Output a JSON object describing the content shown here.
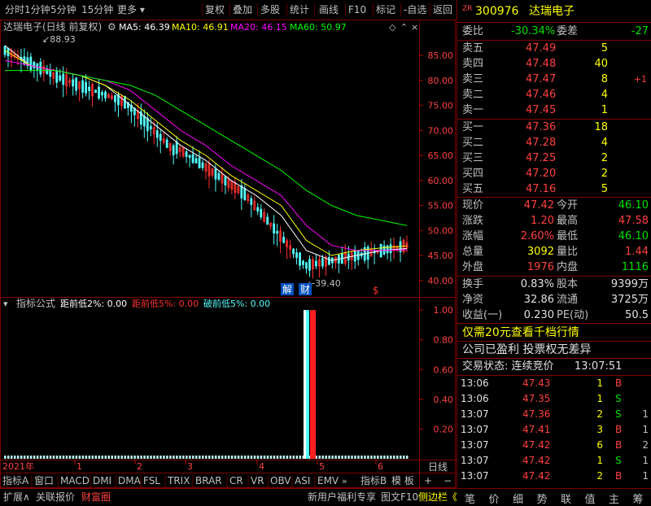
{
  "toolbar": {
    "items": [
      "分时",
      "1分钟",
      "5分钟",
      "15分钟",
      "更多",
      "复权",
      "叠加",
      "多股",
      "统计",
      "画线",
      "F10",
      "标记",
      "-自选",
      "返回"
    ]
  },
  "main_legend": {
    "title": "达瑞电子(日线 前复权)",
    "ma5": "MA5: 46.39",
    "ma10": "MA10: 46.91",
    "ma20": "MA20: 46.15",
    "ma60": "MA60: 50.97"
  },
  "indicator_legend": {
    "name": "指标公式",
    "f1": "距前低2%: 0.00",
    "f2": "距前低5%: 0.00",
    "f3": "破前低5%: 0.00"
  },
  "annotations": {
    "high": "88.93",
    "low": "39.40",
    "mark1": "解",
    "mark2": "财",
    "mark3": "$"
  },
  "axis": {
    "year_label": "2021年",
    "month_labels": [
      "1",
      "2",
      "3",
      "4",
      "5",
      "6"
    ],
    "period": "日线"
  },
  "colors": {
    "ma5": "#ffffff",
    "ma10": "#ffff00",
    "ma20": "#ff00ff",
    "ma60": "#00ff00",
    "up": "#ff3030",
    "down": "#54fcfc",
    "border": "#800000"
  },
  "chart_data": [
    {
      "type": "candlestick",
      "title": "达瑞电子(日线 前复权)",
      "y_ticks": [
        40.0,
        45.0,
        50.0,
        55.0,
        60.0,
        65.0,
        70.0,
        75.0,
        80.0,
        85.0
      ],
      "ylim": [
        38.5,
        88.93
      ],
      "series": [
        {
          "name": "MA5",
          "approx_values": [
            87,
            83,
            82,
            81,
            79,
            75,
            71,
            67,
            64,
            60,
            57,
            53,
            46,
            44,
            45,
            46,
            46.39
          ]
        },
        {
          "name": "MA10",
          "approx_values": [
            86,
            83,
            82,
            81,
            79,
            76,
            72,
            68,
            65,
            61,
            58,
            55,
            48,
            45,
            46,
            46.5,
            46.91
          ]
        },
        {
          "name": "MA20",
          "approx_values": [
            84,
            83,
            82,
            81,
            80,
            78,
            74,
            70,
            67,
            63,
            60,
            57,
            51,
            47,
            46,
            46,
            46.15
          ]
        },
        {
          "name": "MA60",
          "approx_values": [
            82,
            82,
            82,
            81,
            80,
            79,
            77,
            74,
            71,
            68,
            65,
            62,
            58,
            55,
            53,
            52,
            50.97
          ]
        }
      ]
    },
    {
      "type": "bar",
      "title": "指标公式",
      "y_ticks": [
        0.2,
        0.4,
        0.6,
        0.8,
        1.0
      ],
      "ylim": [
        0,
        1.05
      ],
      "series": [
        {
          "name": "距前低2%",
          "value": 0.0
        },
        {
          "name": "距前低5%",
          "value": 0.0
        },
        {
          "name": "破前低5%",
          "value": 0.0
        }
      ],
      "spike_values": [
        1.0,
        1.0
      ]
    }
  ],
  "quote": {
    "badge": "ZR",
    "code": "300976",
    "name": "达瑞电子",
    "weibi_label": "委比",
    "weibi": "-30.34%",
    "weicha_label": "委差",
    "weicha": "-27",
    "asks": [
      {
        "label": "卖五",
        "price": "47.49",
        "vol": "5",
        "chg": ""
      },
      {
        "label": "卖四",
        "price": "47.48",
        "vol": "40",
        "chg": ""
      },
      {
        "label": "卖三",
        "price": "47.47",
        "vol": "8",
        "chg": "+1"
      },
      {
        "label": "卖二",
        "price": "47.46",
        "vol": "4",
        "chg": ""
      },
      {
        "label": "卖一",
        "price": "47.45",
        "vol": "1",
        "chg": ""
      }
    ],
    "bids": [
      {
        "label": "买一",
        "price": "47.36",
        "vol": "18"
      },
      {
        "label": "买二",
        "price": "47.28",
        "vol": "4"
      },
      {
        "label": "买三",
        "price": "47.25",
        "vol": "2"
      },
      {
        "label": "买四",
        "price": "47.20",
        "vol": "2"
      },
      {
        "label": "买五",
        "price": "47.16",
        "vol": "5"
      }
    ],
    "stats": [
      {
        "l1": "现价",
        "v1": "47.42",
        "l2": "今开",
        "v2": "46.10",
        "c1": "red",
        "c2": "grn"
      },
      {
        "l1": "涨跌",
        "v1": "1.20",
        "l2": "最高",
        "v2": "47.58",
        "c1": "red",
        "c2": "red"
      },
      {
        "l1": "涨幅",
        "v1": "2.60%",
        "l2": "最低",
        "v2": "46.10",
        "c1": "red",
        "c2": "grn"
      },
      {
        "l1": "总量",
        "v1": "3092",
        "l2": "量比",
        "v2": "1.44",
        "c1": "yel",
        "c2": "red"
      },
      {
        "l1": "外盘",
        "v1": "1976",
        "l2": "内盘",
        "v2": "1116",
        "c1": "red",
        "c2": "grn"
      }
    ],
    "stats2": [
      {
        "l1": "换手",
        "v1": "0.83%",
        "l2": "股本",
        "v2": "9399万"
      },
      {
        "l1": "净资",
        "v1": "32.86",
        "l2": "流通",
        "v2": "3725万"
      },
      {
        "l1": "收益(一)",
        "v1": "0.230",
        "l2": "PE(动)",
        "v2": "50.5"
      }
    ],
    "promo": "仅需20元查看千档行情",
    "promo_highlight": "20",
    "notice": "公司已盈利 投票权无差异",
    "status_label": "交易状态: 连续竞价",
    "status_time": "13:07:51",
    "ticks": [
      {
        "t": "13:06",
        "p": "47.43",
        "v": "1",
        "s": "B",
        "n": ""
      },
      {
        "t": "13:06",
        "p": "47.35",
        "v": "1",
        "s": "S",
        "n": ""
      },
      {
        "t": "13:07",
        "p": "47.36",
        "v": "2",
        "s": "S",
        "n": "1"
      },
      {
        "t": "13:07",
        "p": "47.41",
        "v": "3",
        "s": "B",
        "n": "1"
      },
      {
        "t": "13:07",
        "p": "47.42",
        "v": "6",
        "s": "B",
        "n": "2"
      },
      {
        "t": "13:07",
        "p": "47.42",
        "v": "1",
        "s": "S",
        "n": "1"
      },
      {
        "t": "13:07",
        "p": "47.42",
        "v": "2",
        "s": "B",
        "n": "1"
      }
    ]
  },
  "indicator_tabs": [
    "指标A",
    "窗口",
    "MACD",
    "DMI",
    "DMA",
    "FSL",
    "TRIX",
    "BRAR",
    "CR",
    "VR",
    "OBV",
    "ASI",
    "EMV"
  ],
  "indicator_tabs_right": [
    "指标B",
    "模 板",
    "+",
    "−"
  ],
  "bottom_bar": {
    "left": [
      "扩展∧",
      "关联报价",
      "财富圈"
    ],
    "right": [
      "新用户福利专享",
      "图文F10",
      "侧边栏《"
    ]
  },
  "right_tabs": [
    "笔",
    "价",
    "细",
    "势",
    "联",
    "值",
    "主",
    "筹"
  ]
}
